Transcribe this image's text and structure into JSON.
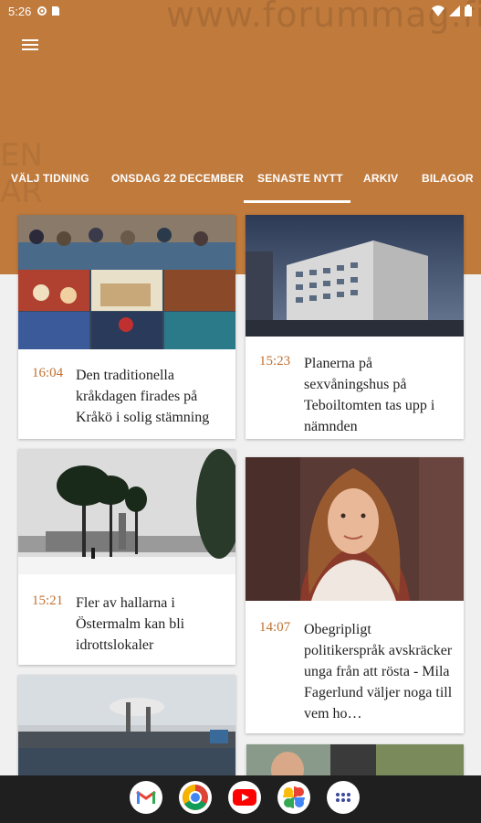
{
  "status_bar": {
    "time": "5:26"
  },
  "watermark": "www.forummag.fi",
  "tabs": [
    {
      "label": "VÄLJ TIDNING"
    },
    {
      "label": "ONSDAG 22 DECEMBER"
    },
    {
      "label": "SENASTE NYTT"
    },
    {
      "label": "ARKIV"
    },
    {
      "label": "BILAGOR"
    }
  ],
  "active_tab": "SENASTE NYTT",
  "articles": [
    {
      "time": "16:04",
      "headline": "Den traditionella kråkdagen firades på Kråkö i solig stämning",
      "image": "collage"
    },
    {
      "time": "15:23",
      "headline": "Planerna på sexvåningshus på Teboiltomten tas upp i nämnden",
      "image": "building"
    },
    {
      "time": "15:21",
      "headline": "Fler av hallarna i Östermalm kan bli idrottslokaler",
      "image": "winter"
    },
    {
      "time": "14:07",
      "headline": "Obegripligt politikerspråk avskräcker unga från att rösta - Mila Fagerlund väljer noga till vem ho…",
      "image": "portrait"
    },
    {
      "time": "",
      "headline": "",
      "image": "industry"
    },
    {
      "time": "",
      "headline": "",
      "image": "people"
    }
  ],
  "dock_apps": [
    "gmail-icon",
    "chrome-icon",
    "youtube-icon",
    "photos-icon",
    "app-drawer-icon"
  ],
  "colors": {
    "brand": "#bf7a3c",
    "time_accent": "#c07030",
    "nav_bar": "#1f1f1f"
  }
}
